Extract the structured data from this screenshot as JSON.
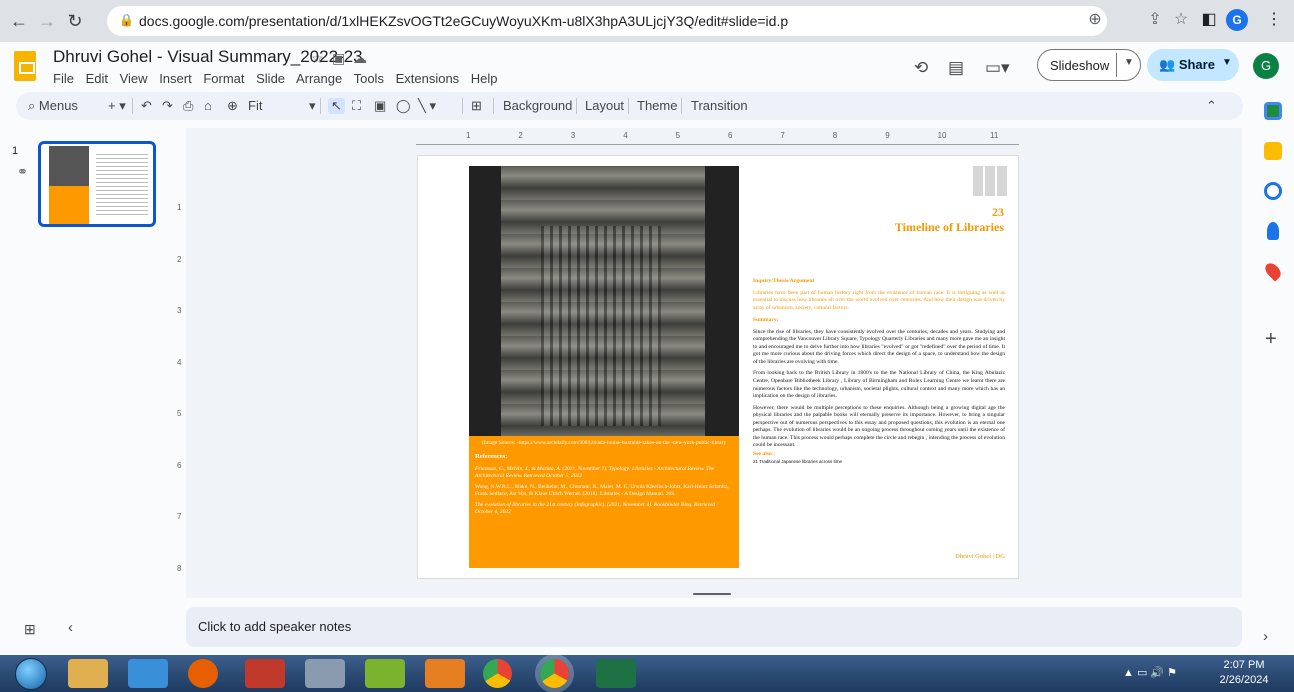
{
  "browser": {
    "url": "docs.google.com/presentation/d/1xlHEKZsvOGTt2eGCuyWoyuXKm-u8lX3hpA3ULjcjY3Q/edit#slide=id.p",
    "profile_initial": "G"
  },
  "doc": {
    "title": "Dhruvi Gohel - Visual Summary_2022-23",
    "menu": [
      "File",
      "Edit",
      "View",
      "Insert",
      "Format",
      "Slide",
      "Arrange",
      "Tools",
      "Extensions",
      "Help"
    ],
    "slideshow_label": "Slideshow",
    "share_label": "Share",
    "account_initial": "G"
  },
  "toolbar": {
    "menus_label": "Menus",
    "zoom_label": "Fit",
    "background_label": "Background",
    "layout_label": "Layout",
    "theme_label": "Theme",
    "transition_label": "Transition"
  },
  "filmstrip": {
    "slide_number": "1"
  },
  "ruler": {
    "h": [
      "1",
      "2",
      "3",
      "4",
      "5",
      "6",
      "7",
      "8",
      "9",
      "10",
      "11"
    ],
    "v": [
      "1",
      "2",
      "3",
      "4",
      "5",
      "6",
      "7",
      "8"
    ]
  },
  "slide": {
    "number": "23",
    "title": "Timeline of Libraries",
    "image_source": "(Image Source: -https://www.archdaily.com/308124/ada-louise-huxtable-takes-on-the -new-york-public-library",
    "references_heading": "References:",
    "ref1": "Friesman, G., Melvin, J., & Maruta, A. (2011, November 7). Typology: Libraries - Architectural Review. The Architectural Review. Retrieved October 5, 2022",
    "ref2": "Wang, N.W.R.L., Blake, N., Beukelar, M., Chomani, R., Maier, M. F., Ursula Kleefisch-Jobst, Karl-Heinz Schmitz, Frank Sedlaco, Ast Vos, & Klaus Ulrich Werner. (2018). Libraries - A Design Manual. 26S.",
    "ref3": "The evolution of libraries in the 21st century (Infographic). (2021, November 4). Bookbinder Blog. Retrieved October 4, 2022",
    "inquiry_heading": "Inquiry/Thesis/Argument",
    "inquiry_text": "Libraries have been part of human history right from the existence of human race. It is intriguing as well as essential to discuss how libraries all over the world evolved over centuries. And how their design was driven by array of urbanism, society, cultural factors.",
    "summary_heading": "Summary:",
    "summary_p1": "Since the rise of libraries, they have consistently evolved over the centuries, decades and years. Studying and comprehending the Vancouver Library Square, Typology Quarterly Libraries and many more gave me an insight to and encouraged me to delve further into how libraries \"evolved\" or got \"redefined\" over the period of time. It got me more curious about the driving forces which direct the design of a space, to understand how the design of the libraries are evolving with time.",
    "summary_p2": "From looking back to the British Library in 1800's to the the National Library of China, the King Abulaziz Centre, Openbare Bibliotheek Library , Library of Birmingham and Rolex Learning Centre we learnt there are numerous factors like the technology, urbanism, societal plights, cultural context and many more which has an implication on the design of libraries.",
    "summary_p3": "However, there would be multiple perceptions to these enquiries. Although being a growing digital age the physical libraries and the palpable books will eternally preserve its importance. However, to bring a singular perspective out of numerous perspectives to this essay and proposed questions, this evolution is an eternal one perhaps. The evolution of libraries would be an ongoing process throughout coming years until the existence of the human race. This process would perhaps complete the circle and rebegin , intending the process of evolution could be incessant.",
    "see_also_heading": "See also :",
    "see_also_text": "21 Traditional Japanese libraries across time",
    "footer": "Dhruvi Gohel | DG"
  },
  "notes": {
    "placeholder": "Click to add speaker notes"
  },
  "taskbar": {
    "time": "2:07 PM",
    "date": "2/26/2024"
  },
  "colors": {
    "accent": "#f29900",
    "orange_box": "#ff9900",
    "share_bg": "#c2e7ff",
    "selection": "#0b57d0"
  }
}
